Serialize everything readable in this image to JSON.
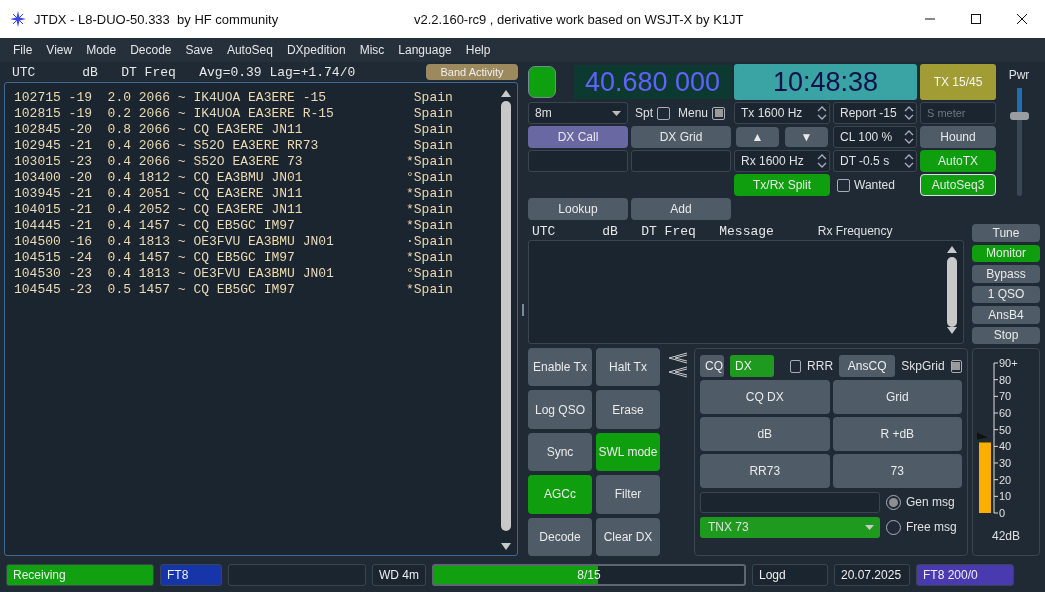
{
  "window": {
    "title": "JTDX - L8-DUO-50.333  by HF community",
    "subtitle": "v2.2.160-rc9 , derivative work based on WSJT-X by K1JT"
  },
  "menu": [
    "File",
    "View",
    "Mode",
    "Decode",
    "Save",
    "AutoSeq",
    "DXpedition",
    "Misc",
    "Language",
    "Help"
  ],
  "band_activity": {
    "header": "UTC      dB   DT Freq   Avg=0.39 Lag=+1.74/0",
    "button": "Band Activity",
    "rows": [
      {
        "text": "102715 -19  2.0 2066 ~ IK4UOA EA3ERE -15",
        "country": " Spain"
      },
      {
        "text": "102815 -19  0.2 2066 ~ IK4UOA EA3ERE R-15",
        "country": " Spain"
      },
      {
        "text": "102845 -20  0.8 2066 ~ CQ EA3ERE JN11",
        "country": " Spain"
      },
      {
        "text": "102945 -21  0.4 2066 ~ S52O EA3ERE RR73",
        "country": " Spain"
      },
      {
        "text": "103015 -23  0.4 2066 ~ S52O EA3ERE 73",
        "country": "*Spain"
      },
      {
        "text": "103400 -20  0.4 1812 ~ CQ EA3BMU JN01",
        "country": "°Spain"
      },
      {
        "text": "103945 -21  0.4 2051 ~ CQ EA3ERE JN11",
        "country": "*Spain"
      },
      {
        "text": "104015 -21  0.4 2052 ~ CQ EA3ERE JN11",
        "country": "*Spain"
      },
      {
        "text": "104445 -21  0.4 1457 ~ CQ EB5GC IM97",
        "country": "*Spain"
      },
      {
        "text": "104500 -16  0.4 1813 ~ OE3FVU EA3BMU JN01",
        "country": "·Spain"
      },
      {
        "text": "104515 -24  0.4 1457 ~ CQ EB5GC IM97",
        "country": "*Spain"
      },
      {
        "text": "104530 -23  0.4 1813 ~ OE3FVU EA3BMU JN01",
        "country": "°Spain"
      },
      {
        "text": "104545 -23  0.5 1457 ~ CQ EB5GC IM97",
        "country": "*Spain"
      }
    ]
  },
  "radio": {
    "led_on": true,
    "frequency": "40.680 000",
    "clock": "10:48:38",
    "tx_period": "TX 15/45",
    "band": "8m",
    "spt": {
      "label": "Spt",
      "checked": false
    },
    "menu": {
      "label": "Menu",
      "checked": true
    },
    "dx_call": "DX Call",
    "dx_grid": "DX Grid",
    "lookup": "Lookup",
    "add": "Add",
    "tx_freq": "Tx  1600  Hz",
    "rx_freq": "Rx  1600  Hz",
    "up": "▲",
    "down": "▼",
    "report": "Report -15",
    "cl": "CL  100 %",
    "dt": "DT -0.5 s",
    "s_meter": {
      "placeholder": "S meter"
    },
    "hound": {
      "label": "Hound",
      "on": false
    },
    "autotx": {
      "label": "AutoTX",
      "on": true
    },
    "autoseq": {
      "label": "AutoSeq3",
      "on": true
    },
    "split": {
      "label": "Tx/Rx Split",
      "on": true
    },
    "wanted": {
      "label": "Wanted",
      "checked": false
    },
    "power": {
      "label": "Pwr",
      "level": 0.73
    }
  },
  "rx_frequency": {
    "header": "UTC      dB   DT Freq   Message",
    "title": "Rx Frequency"
  },
  "side_buttons": [
    {
      "label": "Tune",
      "on": false
    },
    {
      "label": "Monitor",
      "on": true
    },
    {
      "label": "Bypass",
      "on": false
    },
    {
      "label": "1 QSO",
      "on": false
    },
    {
      "label": "AnsB4",
      "on": false
    },
    {
      "label": "Stop",
      "on": false
    }
  ],
  "action_buttons": [
    {
      "label": "Enable Tx",
      "on": false
    },
    {
      "label": "Halt Tx",
      "on": false
    },
    {
      "label": "Log QSO",
      "on": false
    },
    {
      "label": "Erase",
      "on": false
    },
    {
      "label": "Sync",
      "on": false
    },
    {
      "label": "SWL mode",
      "on": true
    },
    {
      "label": "AGCc",
      "on": true
    },
    {
      "label": "Filter",
      "on": false
    },
    {
      "label": "Decode",
      "on": false
    },
    {
      "label": "Clear DX",
      "on": false
    }
  ],
  "messages": {
    "tabs": [
      {
        "label": "CQ",
        "selected": false
      },
      {
        "label": "DX",
        "selected": true
      }
    ],
    "rrr": {
      "label": "RRR",
      "checked": false
    },
    "anscq": "AnsCQ",
    "skpgrid": {
      "label": "SkpGrid",
      "checked": true
    },
    "buttons": [
      "CQ DX",
      "Grid",
      "dB",
      "R +dB",
      "RR73",
      "73"
    ],
    "select": "TNX 73",
    "radios": [
      {
        "label": "Gen msg",
        "selected": true
      },
      {
        "label": "Free msg",
        "selected": false
      }
    ]
  },
  "meter": {
    "ticks": [
      "90+",
      "80",
      "70",
      "60",
      "50",
      "40",
      "30",
      "20",
      "10",
      "0"
    ],
    "level": 0.47,
    "reading": "42dB"
  },
  "status": [
    {
      "kind": "cell",
      "text": "Receiving",
      "color": "#10a010"
    },
    {
      "kind": "cell",
      "text": "FT8",
      "color": "#1535a8"
    },
    {
      "kind": "empty"
    },
    {
      "kind": "cell",
      "text": "WD 4m"
    },
    {
      "kind": "progress",
      "text": "8/15",
      "level": 0.53
    },
    {
      "kind": "cell",
      "text": "Logd"
    },
    {
      "kind": "cell",
      "text": "20.07.2025"
    },
    {
      "kind": "cell",
      "text": "FT8  200/0",
      "color": "#4a3ab0"
    }
  ]
}
